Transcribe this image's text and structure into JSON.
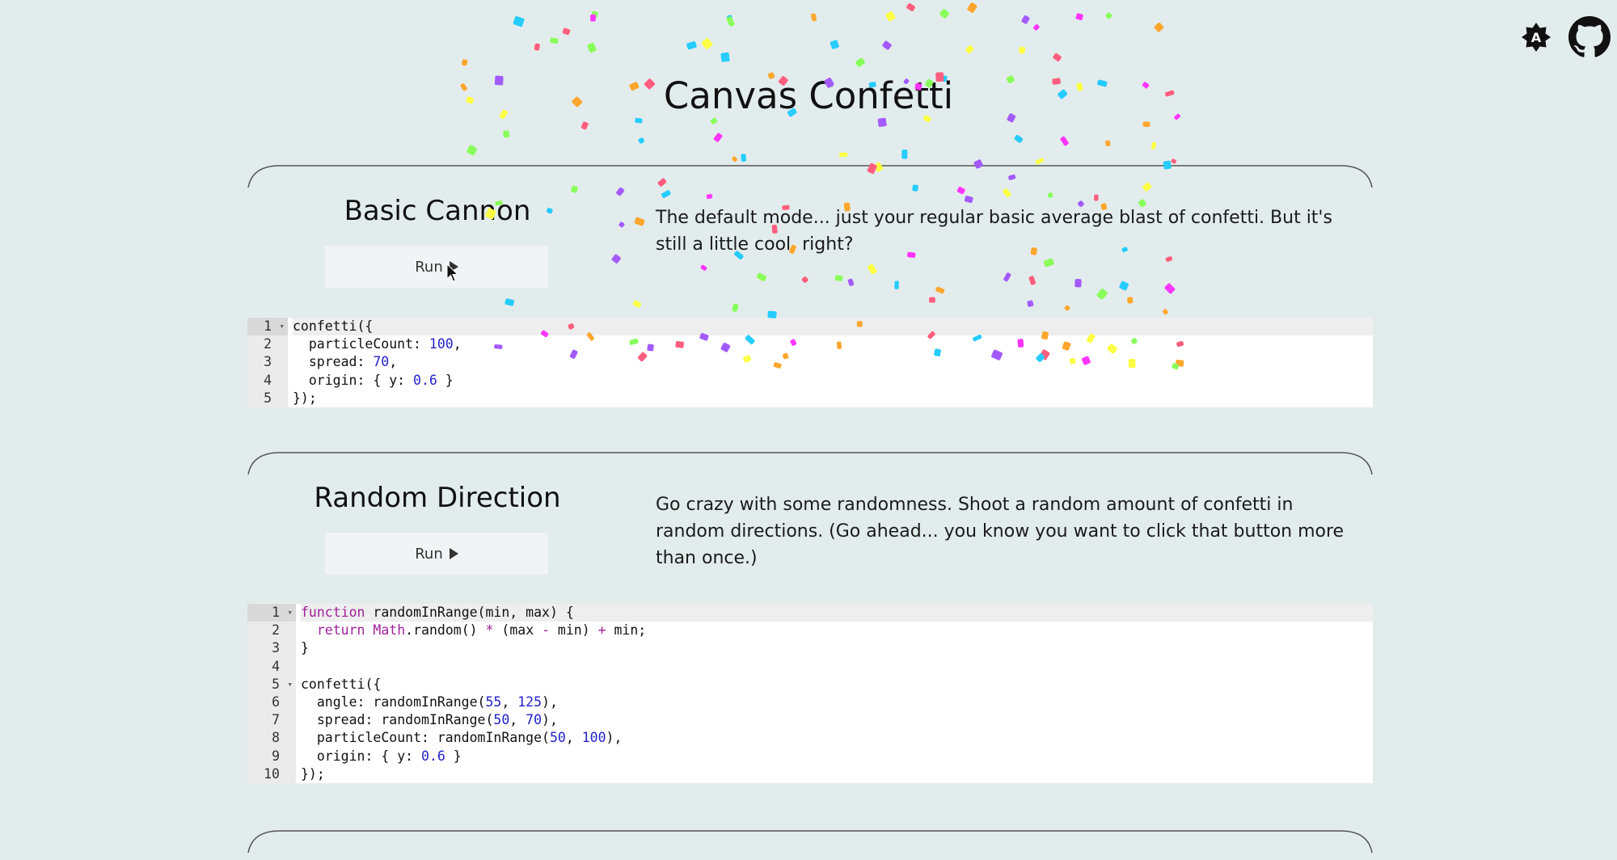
{
  "page": {
    "title": "Canvas Confetti",
    "background": "#e3ecec"
  },
  "header_icons": [
    {
      "name": "theme-toggle-icon",
      "glyph": "A"
    },
    {
      "name": "github-icon"
    }
  ],
  "sections": [
    {
      "title": "Basic Cannon",
      "button_label": "Run",
      "description": "The default mode... just your regular basic average blast of confetti. But it's still a little cool, right?",
      "code": [
        [
          [
            "t",
            "confetti({"
          ]
        ],
        [
          [
            "t",
            "  particleCount: "
          ],
          [
            "n",
            "100"
          ],
          [
            "t",
            ","
          ]
        ],
        [
          [
            "t",
            "  spread: "
          ],
          [
            "n",
            "70"
          ],
          [
            "t",
            ","
          ]
        ],
        [
          [
            "t",
            "  origin: { y: "
          ],
          [
            "n",
            "0.6"
          ],
          [
            "t",
            " }"
          ]
        ],
        [
          [
            "t",
            "});"
          ]
        ]
      ]
    },
    {
      "title": "Random Direction",
      "button_label": "Run",
      "description": "Go crazy with some randomness. Shoot a random amount of confetti in random directions. (Go ahead... you know you want to click that button more than once.)",
      "code": [
        [
          [
            "k",
            "function"
          ],
          [
            "t",
            " randomInRange(min, max) {"
          ]
        ],
        [
          [
            "t",
            "  "
          ],
          [
            "k",
            "return"
          ],
          [
            "t",
            " "
          ],
          [
            "o",
            "Math"
          ],
          [
            "t",
            ".random() "
          ],
          [
            "k",
            "*"
          ],
          [
            "t",
            " (max "
          ],
          [
            "k",
            "-"
          ],
          [
            "t",
            " min) "
          ],
          [
            "k",
            "+"
          ],
          [
            "t",
            " min;"
          ]
        ],
        [
          [
            "t",
            "}"
          ]
        ],
        [
          [
            "t",
            ""
          ]
        ],
        [
          [
            "t",
            "confetti({"
          ]
        ],
        [
          [
            "t",
            "  angle: randomInRange("
          ],
          [
            "n",
            "55"
          ],
          [
            "t",
            ", "
          ],
          [
            "n",
            "125"
          ],
          [
            "t",
            "),"
          ]
        ],
        [
          [
            "t",
            "  spread: randomInRange("
          ],
          [
            "n",
            "50"
          ],
          [
            "t",
            ", "
          ],
          [
            "n",
            "70"
          ],
          [
            "t",
            "),"
          ]
        ],
        [
          [
            "t",
            "  particleCount: randomInRange("
          ],
          [
            "n",
            "50"
          ],
          [
            "t",
            ", "
          ],
          [
            "n",
            "100"
          ],
          [
            "t",
            "),"
          ]
        ],
        [
          [
            "t",
            "  origin: { y: "
          ],
          [
            "n",
            "0.6"
          ],
          [
            "t",
            " }"
          ]
        ],
        [
          [
            "t",
            "});"
          ]
        ]
      ]
    }
  ],
  "confetti_colors": [
    "#26ccff",
    "#a25afd",
    "#ff5e7e",
    "#88ff5a",
    "#fcff42",
    "#ffa62d",
    "#ff36ff"
  ]
}
